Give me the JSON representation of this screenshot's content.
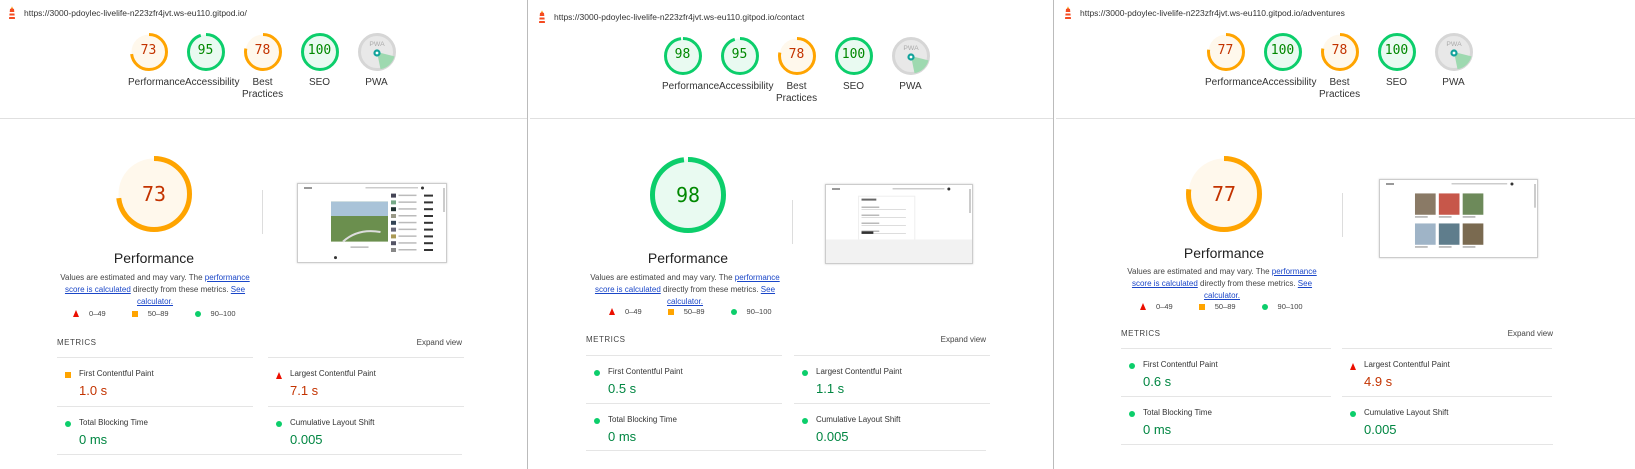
{
  "colors": {
    "fail": "#eb0f00",
    "average": "#ffa400",
    "pass": "#0cce6b",
    "pwa": "#bdbdbd"
  },
  "panels": [
    {
      "url": "https://3000-pdoylec-livelife-n223zfr4jvt.ws-eu110.gitpod.io/",
      "gauges": [
        {
          "score": "73",
          "label": "Performance",
          "rating": "average"
        },
        {
          "score": "95",
          "label": "Accessibility",
          "rating": "pass"
        },
        {
          "score": "78",
          "label": "Best Practices",
          "rating": "average"
        },
        {
          "score": "100",
          "label": "SEO",
          "rating": "pass"
        },
        {
          "score": "",
          "label": "PWA",
          "rating": "pwa"
        }
      ],
      "big_score": "73",
      "big_rating": "average",
      "big_label": "Performance",
      "note_prefix": "Values are estimated and may vary. The ",
      "note_link1": "performance score is calculated",
      "note_mid": " directly from these metrics. ",
      "note_link2": "See calculator.",
      "legend": [
        "0–49",
        "50–89",
        "90–100"
      ],
      "metrics_title": "METRICS",
      "expand": "Expand view",
      "metrics": [
        {
          "label": "First Contentful Paint",
          "value": "1.0 s",
          "rating": "average"
        },
        {
          "label": "Largest Contentful Paint",
          "value": "7.1 s",
          "rating": "fail"
        },
        {
          "label": "Total Blocking Time",
          "value": "0 ms",
          "rating": "pass"
        },
        {
          "label": "Cumulative Layout Shift",
          "value": "0.005",
          "rating": "pass"
        }
      ]
    },
    {
      "url": "https://3000-pdoylec-livelife-n223zfr4jvt.ws-eu110.gitpod.io/contact",
      "gauges": [
        {
          "score": "98",
          "label": "Performance",
          "rating": "pass"
        },
        {
          "score": "95",
          "label": "Accessibility",
          "rating": "pass"
        },
        {
          "score": "78",
          "label": "Best Practices",
          "rating": "average"
        },
        {
          "score": "100",
          "label": "SEO",
          "rating": "pass"
        },
        {
          "score": "",
          "label": "PWA",
          "rating": "pwa"
        }
      ],
      "big_score": "98",
      "big_rating": "pass",
      "big_label": "Performance",
      "note_prefix": "Values are estimated and may vary. The ",
      "note_link1": "performance score is calculated",
      "note_mid": " directly from these metrics. ",
      "note_link2": "See calculator.",
      "legend": [
        "0–49",
        "50–89",
        "90–100"
      ],
      "metrics_title": "METRICS",
      "expand": "Expand view",
      "metrics": [
        {
          "label": "First Contentful Paint",
          "value": "0.5 s",
          "rating": "pass"
        },
        {
          "label": "Largest Contentful Paint",
          "value": "1.1 s",
          "rating": "pass"
        },
        {
          "label": "Total Blocking Time",
          "value": "0 ms",
          "rating": "pass"
        },
        {
          "label": "Cumulative Layout Shift",
          "value": "0.005",
          "rating": "pass"
        }
      ]
    },
    {
      "url": "https://3000-pdoylec-livelife-n223zfr4jvt.ws-eu110.gitpod.io/adventures",
      "gauges": [
        {
          "score": "77",
          "label": "Performance",
          "rating": "average"
        },
        {
          "score": "100",
          "label": "Accessibility",
          "rating": "pass"
        },
        {
          "score": "78",
          "label": "Best Practices",
          "rating": "average"
        },
        {
          "score": "100",
          "label": "SEO",
          "rating": "pass"
        },
        {
          "score": "",
          "label": "PWA",
          "rating": "pwa"
        }
      ],
      "big_score": "77",
      "big_rating": "average",
      "big_label": "Performance",
      "note_prefix": "Values are estimated and may vary. The ",
      "note_link1": "performance score is calculated",
      "note_mid": " directly from these metrics. ",
      "note_link2": "See calculator.",
      "legend": [
        "0–49",
        "50–89",
        "90–100"
      ],
      "metrics_title": "METRICS",
      "expand": "Expand view",
      "metrics": [
        {
          "label": "First Contentful Paint",
          "value": "0.6 s",
          "rating": "pass"
        },
        {
          "label": "Largest Contentful Paint",
          "value": "4.9 s",
          "rating": "fail"
        },
        {
          "label": "Total Blocking Time",
          "value": "0 ms",
          "rating": "pass"
        },
        {
          "label": "Cumulative Layout Shift",
          "value": "0.005",
          "rating": "pass"
        }
      ]
    }
  ]
}
